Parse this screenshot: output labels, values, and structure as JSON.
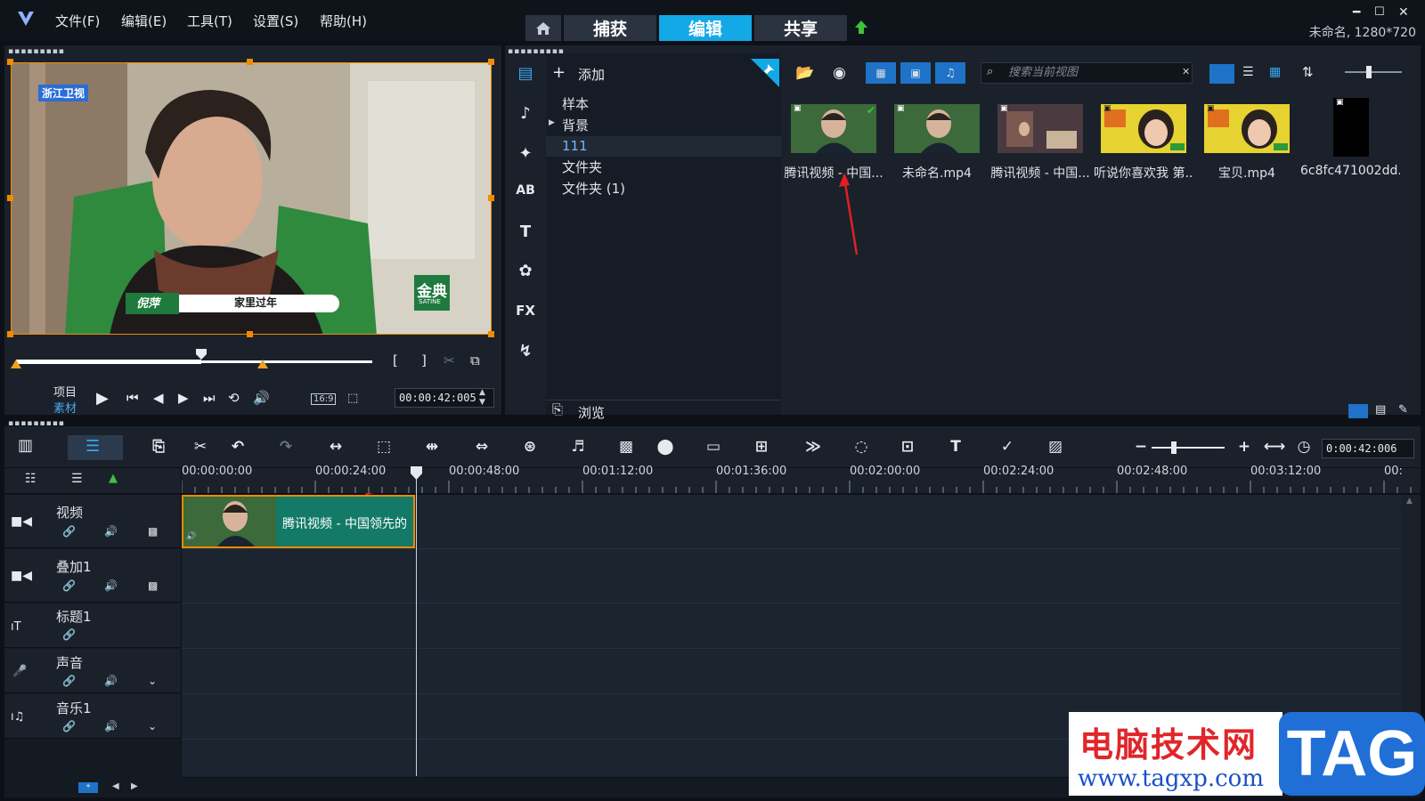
{
  "menu": {
    "file": "文件(F)",
    "edit": "编辑(E)",
    "tools": "工具(T)",
    "settings": "设置(S)",
    "help": "帮助(H)"
  },
  "tabs": {
    "capture": "捕获",
    "edit": "编辑",
    "share": "共享"
  },
  "project_info": "未命名, 1280*720",
  "preview": {
    "channel_logo": "浙江卫视",
    "caption_name": "倪萍",
    "caption_text": "家里过年",
    "badge": "金典",
    "badge_sub": "SATINE",
    "mode_project": "项目",
    "mode_clip": "素材",
    "aspect": "16:9",
    "timecode": "00:00:42:005",
    "scrub_progress": 0.52
  },
  "library": {
    "add_label": "添加",
    "browse_label": "浏览",
    "search_placeholder": "搜索当前视图",
    "folders": [
      "样本",
      "背景",
      "111",
      "文件夹",
      "文件夹 (1)"
    ],
    "media": [
      {
        "label": "腾讯视频 - 中国...",
        "color": "#4f6b3a"
      },
      {
        "label": "未命名.mp4",
        "color": "#546b3e"
      },
      {
        "label": "腾讯视频 - 中国...",
        "color": "#4a3a40"
      },
      {
        "label": "听说你喜欢我 第...",
        "color": "#e6d230"
      },
      {
        "label": "宝贝.mp4",
        "color": "#e6d230"
      },
      {
        "label": "6c8fc471002dd...",
        "color": "#000000"
      }
    ]
  },
  "timeline": {
    "timecode": "0:00:42:006",
    "ticks": [
      "00:00:00:00",
      "00:00:24:00",
      "00:00:48:00",
      "00:01:12:00",
      "00:01:36:00",
      "00:02:00:00",
      "00:02:24:00",
      "00:02:48:00",
      "00:03:12:00",
      "00:"
    ],
    "tracks": [
      "视频",
      "叠加1",
      "标题1",
      "声音",
      "音乐1"
    ],
    "clip_label": "腾讯视频 - 中国领先的"
  },
  "watermark": {
    "title": "电脑技术网",
    "url": "www.tagxp.com",
    "tag": "TAG"
  },
  "colors": {
    "accent": "#13a8e6",
    "selection": "#f08a00",
    "clip": "#137a68"
  }
}
